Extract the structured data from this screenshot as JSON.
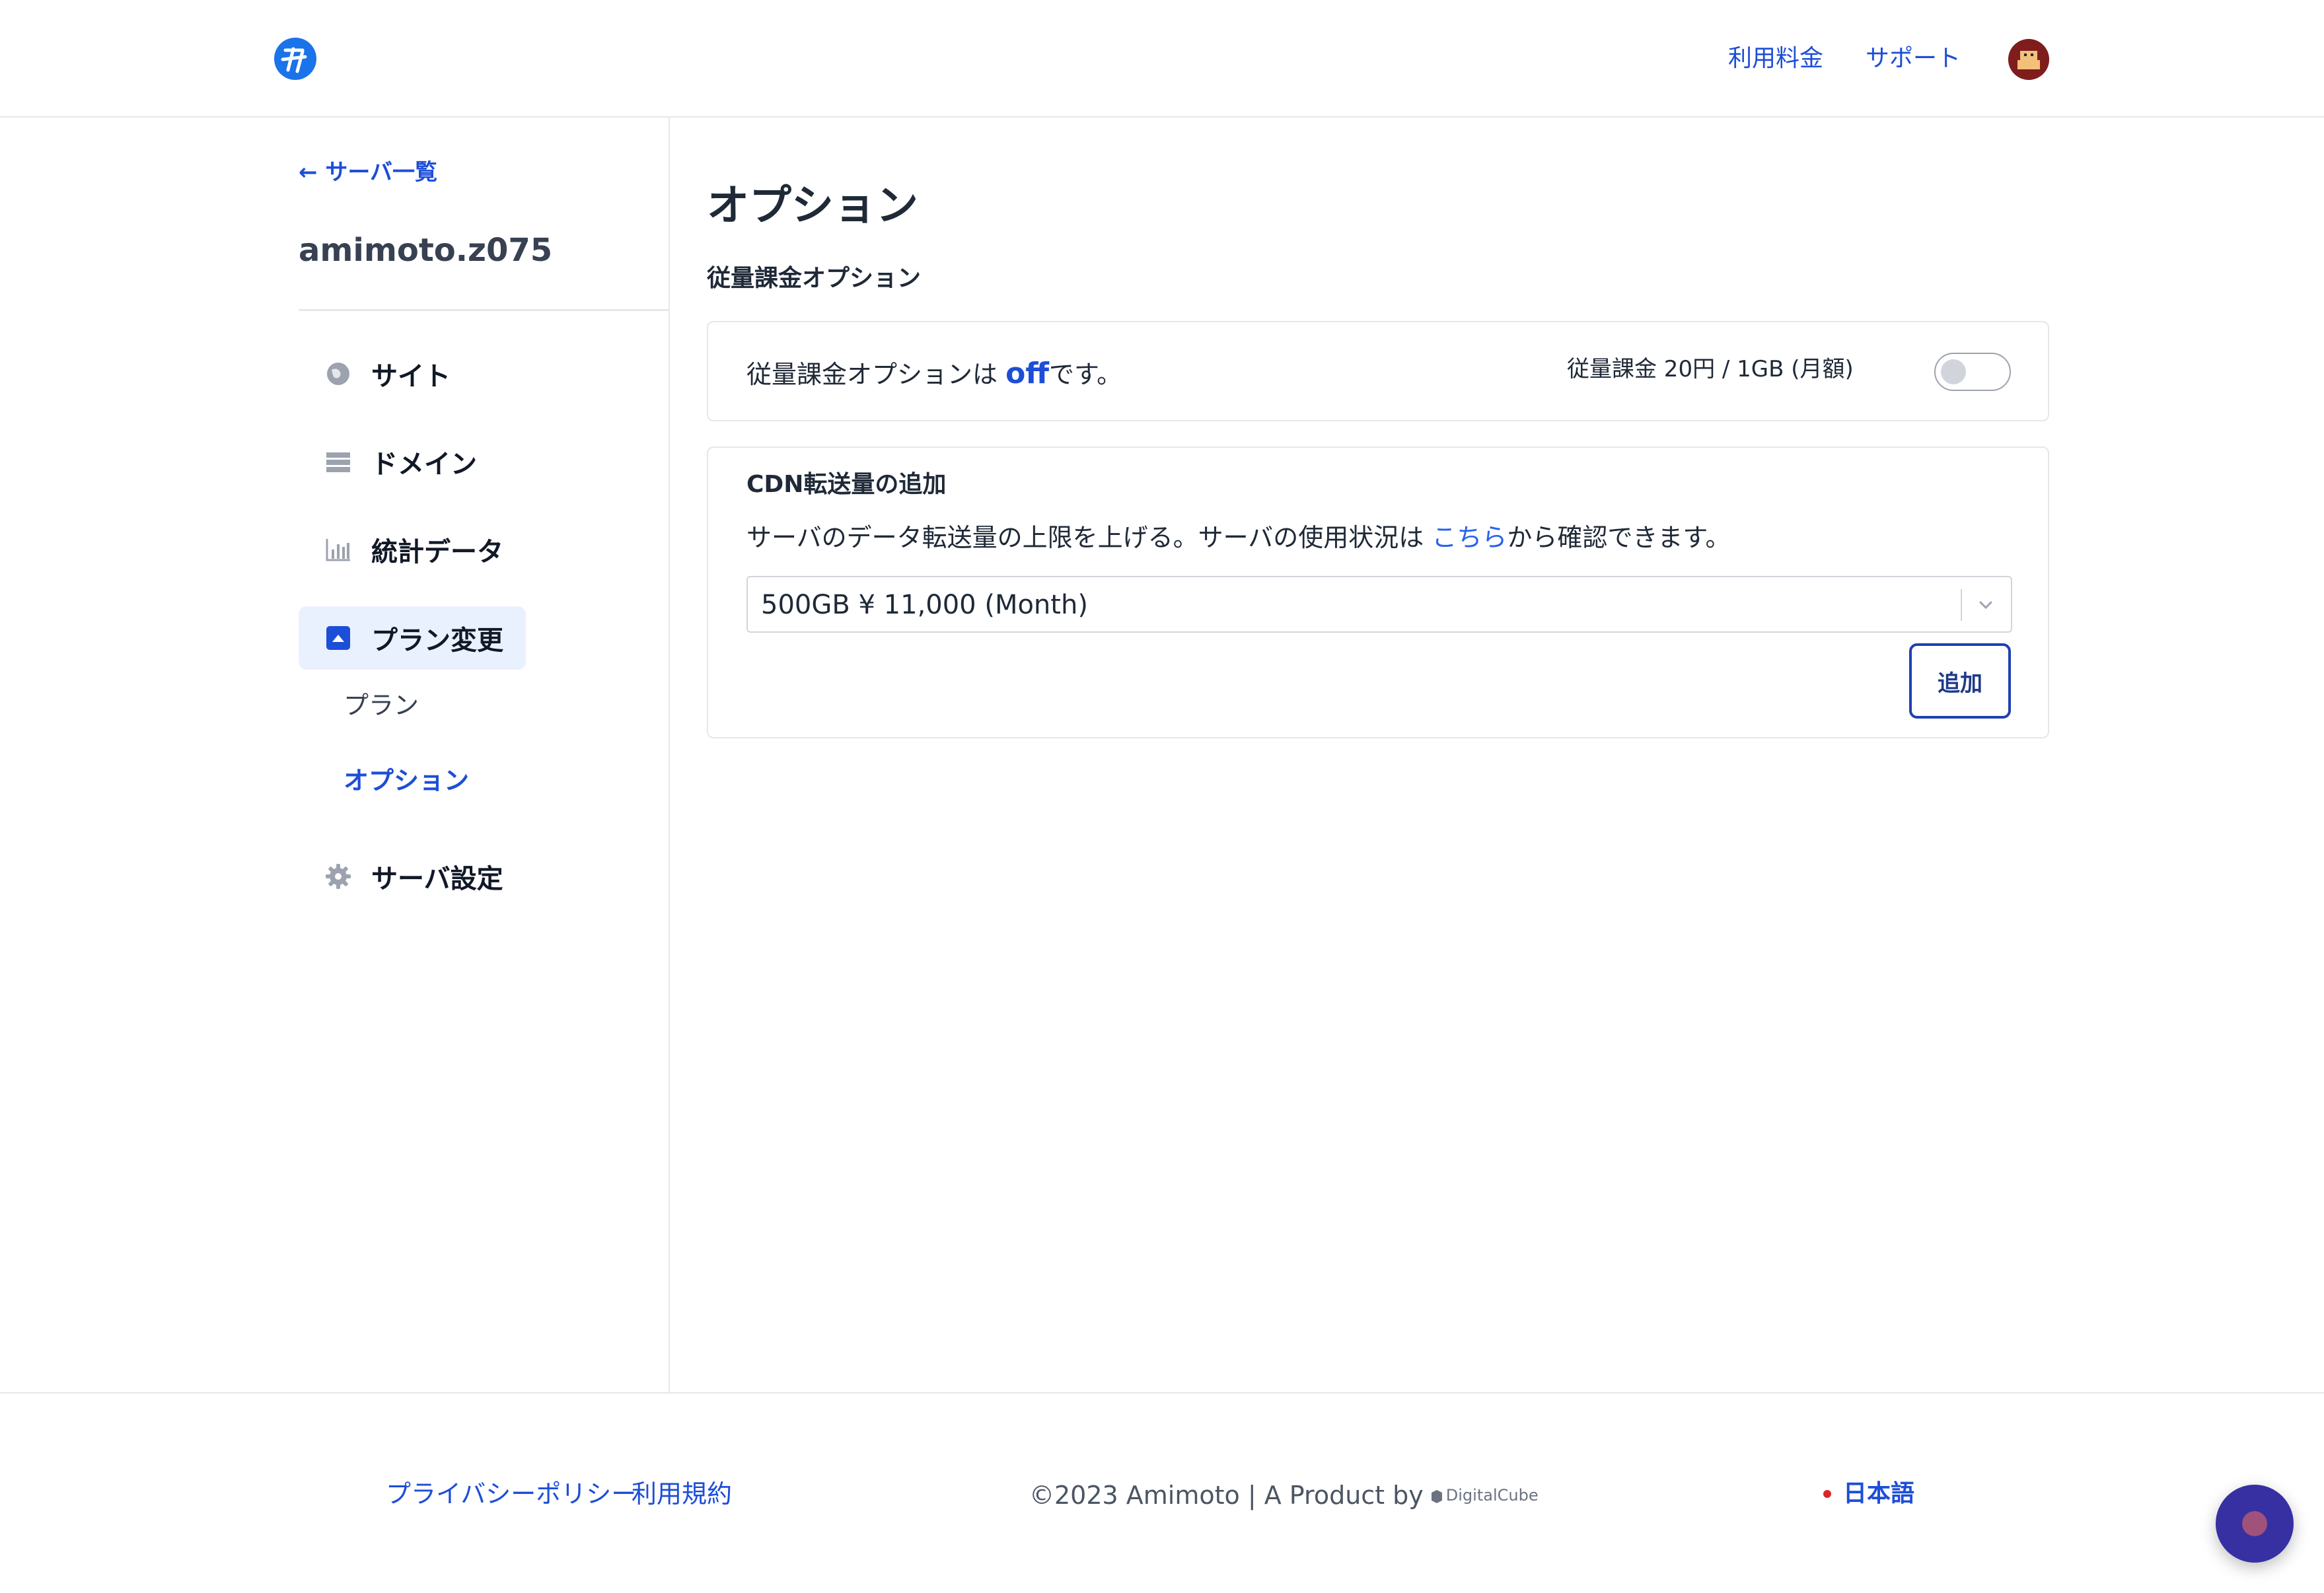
{
  "header": {
    "links": [
      {
        "label": "利用料金"
      },
      {
        "label": "サポート"
      }
    ]
  },
  "sidebar": {
    "back_label": "← サーバ一覧",
    "server_name": "amimoto.z075",
    "nav": [
      {
        "label": "サイト",
        "icon": "globe-icon"
      },
      {
        "label": "ドメイン",
        "icon": "server-icon"
      },
      {
        "label": "統計データ",
        "icon": "bar-chart-icon"
      },
      {
        "label": "プラン変更",
        "icon": "caret-up-square-icon",
        "active": true
      },
      {
        "label": "サーバ設定",
        "icon": "gear-icon"
      }
    ],
    "sub_items": [
      {
        "label": "プラン"
      },
      {
        "label": "オプション",
        "active": true
      }
    ]
  },
  "main": {
    "title": "オプション",
    "section_title": "従量課金オプション",
    "metered": {
      "prefix": "従量課金オプションは ",
      "status": "off",
      "suffix": "です。",
      "price": "従量課金 20円 / 1GB (月額)",
      "enabled": false
    },
    "cdn": {
      "title": "CDN転送量の追加",
      "desc_prefix": "サーバのデータ転送量の上限を上げる。サーバの使用状況は ",
      "desc_link": "こちら",
      "desc_suffix": "から確認できます。",
      "selected_option": "500GB ¥ 11,000 (Month)",
      "add_label": "追加"
    }
  },
  "footer": {
    "privacy": "プライバシーポリシー",
    "terms": "利用規約",
    "copyright": "©2023 Amimoto | A Product by",
    "company": "DigitalCube",
    "language": "日本語"
  },
  "colors": {
    "accent": "#1d4ed8",
    "active_bg": "#eaf1fe",
    "border": "#e5e7eb",
    "chat": "#3730a3"
  }
}
